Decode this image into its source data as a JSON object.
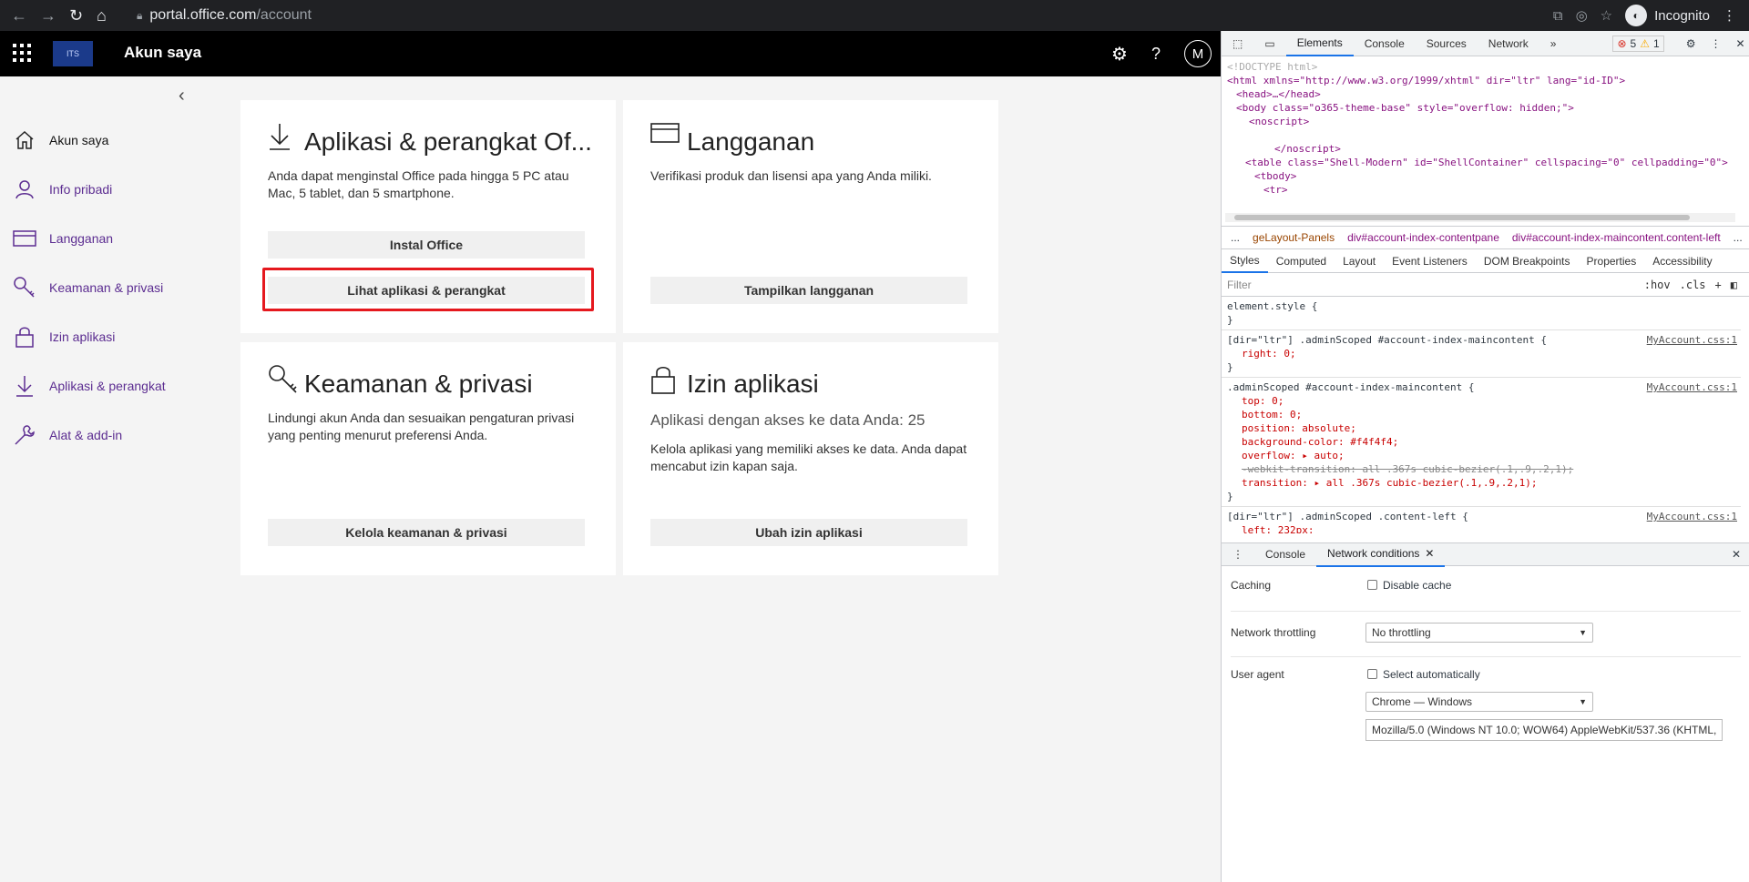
{
  "browser": {
    "url_host": "portal.office.com",
    "url_path": "/account",
    "profile_label": "Incognito"
  },
  "header": {
    "logo_text": "ITS",
    "title": "Akun saya",
    "avatar_initial": "M"
  },
  "sidebar": {
    "items": [
      {
        "label": "Akun saya"
      },
      {
        "label": "Info pribadi"
      },
      {
        "label": "Langganan"
      },
      {
        "label": "Keamanan & privasi"
      },
      {
        "label": "Izin aplikasi"
      },
      {
        "label": "Aplikasi & perangkat"
      },
      {
        "label": "Alat & add-in"
      }
    ]
  },
  "cards": {
    "apps": {
      "title": "Aplikasi & perangkat Of...",
      "desc": "Anda dapat menginstal Office pada hingga 5 PC atau Mac, 5 tablet, dan 5 smartphone.",
      "btn1": "Instal Office",
      "btn2": "Lihat aplikasi & perangkat"
    },
    "subs": {
      "title": "Langganan",
      "desc": "Verifikasi produk dan lisensi apa yang Anda miliki.",
      "btn": "Tampilkan langganan"
    },
    "security": {
      "title": "Keamanan & privasi",
      "desc": "Lindungi akun Anda dan sesuaikan pengaturan privasi yang penting menurut preferensi Anda.",
      "btn": "Kelola keamanan & privasi"
    },
    "perms": {
      "title": "Izin aplikasi",
      "sub": "Aplikasi dengan akses ke data Anda: 25",
      "desc": "Kelola aplikasi yang memiliki akses ke data. Anda dapat mencabut izin kapan saja.",
      "btn": "Ubah izin aplikasi"
    }
  },
  "devtools": {
    "tabs": [
      "Elements",
      "Console",
      "Sources",
      "Network"
    ],
    "error_count": "5",
    "warning_count": "1",
    "dom_lines": [
      "<!DOCTYPE html>",
      "<html xmlns=\"http://www.w3.org/1999/xhtml\" dir=\"ltr\" lang=\"id-ID\">",
      "<head>…</head>",
      "<body class=\"o365-theme-base\" style=\"overflow: hidden;\">",
      "<noscript>",
      "</noscript>",
      "<table class=\"Shell-Modern\" id=\"ShellContainer\" cellspacing=\"0\" cellpadding=\"0\">",
      "<tbody>",
      "<tr>"
    ],
    "crumbs": [
      "...",
      "geLayout-Panels",
      "div#account-index-contentpane",
      "div#account-index-maincontent.content-left",
      "..."
    ],
    "style_tabs": [
      "Styles",
      "Computed",
      "Layout",
      "Event Listeners",
      "DOM Breakpoints",
      "Properties",
      "Accessibility"
    ],
    "filter_placeholder": "Filter",
    "filter_hov": ":hov",
    "filter_cls": ".cls",
    "rules": {
      "r0_selector": "element.style {",
      "r1_selector": "[dir=\"ltr\"] .adminScoped #account-index-maincontent {",
      "r1_src": "MyAccount.css:1",
      "r1_p1": "right: 0;",
      "r2_selector": ".adminScoped #account-index-maincontent {",
      "r2_src": "MyAccount.css:1",
      "r2_p1": "top: 0;",
      "r2_p2": "bottom: 0;",
      "r2_p3": "position: absolute;",
      "r2_p4": "background-color: #f4f4f4;",
      "r2_p5": "overflow: ▸ auto;",
      "r2_p6": "-webkit-transition: all .367s cubic-bezier(.1,.9,.2,1);",
      "r2_p7": "transition: ▸ all .367s cubic-bezier(.1,.9,.2,1);",
      "r3_selector": "[dir=\"ltr\"] .adminScoped .content-left {",
      "r3_src": "MyAccount.css:1",
      "r3_p1": "left: 232px;",
      "close": "}"
    },
    "drawer_tabs": [
      "Console",
      "Network conditions"
    ],
    "network_conditions": {
      "caching_label": "Caching",
      "disable_cache": "Disable cache",
      "throttling_label": "Network throttling",
      "throttling_value": "No throttling",
      "ua_label": "User agent",
      "select_auto": "Select automatically",
      "ua_value": "Chrome — Windows",
      "ua_string": "Mozilla/5.0 (Windows NT 10.0; WOW64) AppleWebKit/537.36 (KHTML,"
    }
  }
}
